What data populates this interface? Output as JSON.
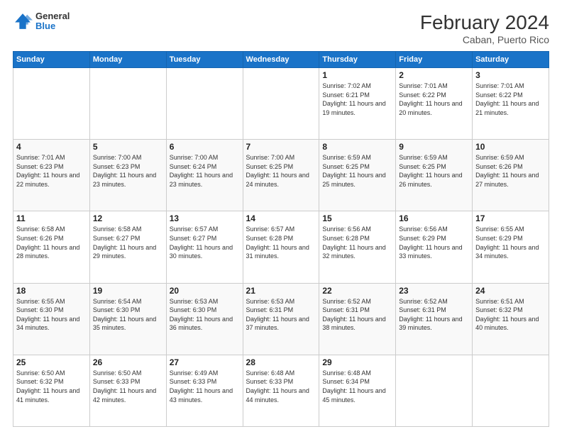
{
  "header": {
    "logo_line1": "General",
    "logo_line2": "Blue",
    "title": "February 2024",
    "subtitle": "Caban, Puerto Rico"
  },
  "days_of_week": [
    "Sunday",
    "Monday",
    "Tuesday",
    "Wednesday",
    "Thursday",
    "Friday",
    "Saturday"
  ],
  "weeks": [
    [
      {
        "day": "",
        "info": ""
      },
      {
        "day": "",
        "info": ""
      },
      {
        "day": "",
        "info": ""
      },
      {
        "day": "",
        "info": ""
      },
      {
        "day": "1",
        "info": "Sunrise: 7:02 AM\nSunset: 6:21 PM\nDaylight: 11 hours and 19 minutes."
      },
      {
        "day": "2",
        "info": "Sunrise: 7:01 AM\nSunset: 6:22 PM\nDaylight: 11 hours and 20 minutes."
      },
      {
        "day": "3",
        "info": "Sunrise: 7:01 AM\nSunset: 6:22 PM\nDaylight: 11 hours and 21 minutes."
      }
    ],
    [
      {
        "day": "4",
        "info": "Sunrise: 7:01 AM\nSunset: 6:23 PM\nDaylight: 11 hours and 22 minutes."
      },
      {
        "day": "5",
        "info": "Sunrise: 7:00 AM\nSunset: 6:23 PM\nDaylight: 11 hours and 23 minutes."
      },
      {
        "day": "6",
        "info": "Sunrise: 7:00 AM\nSunset: 6:24 PM\nDaylight: 11 hours and 23 minutes."
      },
      {
        "day": "7",
        "info": "Sunrise: 7:00 AM\nSunset: 6:25 PM\nDaylight: 11 hours and 24 minutes."
      },
      {
        "day": "8",
        "info": "Sunrise: 6:59 AM\nSunset: 6:25 PM\nDaylight: 11 hours and 25 minutes."
      },
      {
        "day": "9",
        "info": "Sunrise: 6:59 AM\nSunset: 6:25 PM\nDaylight: 11 hours and 26 minutes."
      },
      {
        "day": "10",
        "info": "Sunrise: 6:59 AM\nSunset: 6:26 PM\nDaylight: 11 hours and 27 minutes."
      }
    ],
    [
      {
        "day": "11",
        "info": "Sunrise: 6:58 AM\nSunset: 6:26 PM\nDaylight: 11 hours and 28 minutes."
      },
      {
        "day": "12",
        "info": "Sunrise: 6:58 AM\nSunset: 6:27 PM\nDaylight: 11 hours and 29 minutes."
      },
      {
        "day": "13",
        "info": "Sunrise: 6:57 AM\nSunset: 6:27 PM\nDaylight: 11 hours and 30 minutes."
      },
      {
        "day": "14",
        "info": "Sunrise: 6:57 AM\nSunset: 6:28 PM\nDaylight: 11 hours and 31 minutes."
      },
      {
        "day": "15",
        "info": "Sunrise: 6:56 AM\nSunset: 6:28 PM\nDaylight: 11 hours and 32 minutes."
      },
      {
        "day": "16",
        "info": "Sunrise: 6:56 AM\nSunset: 6:29 PM\nDaylight: 11 hours and 33 minutes."
      },
      {
        "day": "17",
        "info": "Sunrise: 6:55 AM\nSunset: 6:29 PM\nDaylight: 11 hours and 34 minutes."
      }
    ],
    [
      {
        "day": "18",
        "info": "Sunrise: 6:55 AM\nSunset: 6:30 PM\nDaylight: 11 hours and 34 minutes."
      },
      {
        "day": "19",
        "info": "Sunrise: 6:54 AM\nSunset: 6:30 PM\nDaylight: 11 hours and 35 minutes."
      },
      {
        "day": "20",
        "info": "Sunrise: 6:53 AM\nSunset: 6:30 PM\nDaylight: 11 hours and 36 minutes."
      },
      {
        "day": "21",
        "info": "Sunrise: 6:53 AM\nSunset: 6:31 PM\nDaylight: 11 hours and 37 minutes."
      },
      {
        "day": "22",
        "info": "Sunrise: 6:52 AM\nSunset: 6:31 PM\nDaylight: 11 hours and 38 minutes."
      },
      {
        "day": "23",
        "info": "Sunrise: 6:52 AM\nSunset: 6:31 PM\nDaylight: 11 hours and 39 minutes."
      },
      {
        "day": "24",
        "info": "Sunrise: 6:51 AM\nSunset: 6:32 PM\nDaylight: 11 hours and 40 minutes."
      }
    ],
    [
      {
        "day": "25",
        "info": "Sunrise: 6:50 AM\nSunset: 6:32 PM\nDaylight: 11 hours and 41 minutes."
      },
      {
        "day": "26",
        "info": "Sunrise: 6:50 AM\nSunset: 6:33 PM\nDaylight: 11 hours and 42 minutes."
      },
      {
        "day": "27",
        "info": "Sunrise: 6:49 AM\nSunset: 6:33 PM\nDaylight: 11 hours and 43 minutes."
      },
      {
        "day": "28",
        "info": "Sunrise: 6:48 AM\nSunset: 6:33 PM\nDaylight: 11 hours and 44 minutes."
      },
      {
        "day": "29",
        "info": "Sunrise: 6:48 AM\nSunset: 6:34 PM\nDaylight: 11 hours and 45 minutes."
      },
      {
        "day": "",
        "info": ""
      },
      {
        "day": "",
        "info": ""
      }
    ]
  ]
}
